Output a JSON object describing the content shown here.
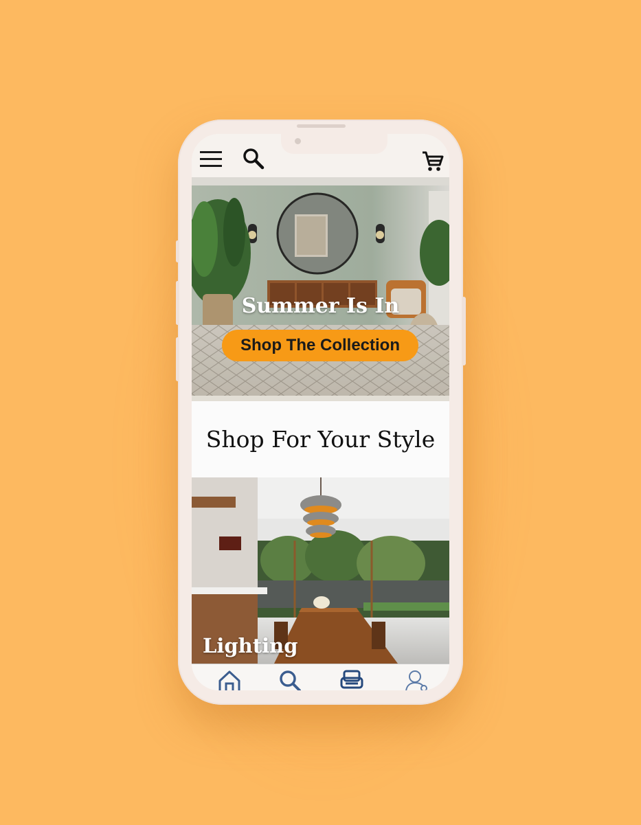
{
  "header": {
    "menu_icon": "hamburger-menu-icon",
    "search_icon": "search-icon",
    "cart_icon": "shopping-cart-icon"
  },
  "hero": {
    "title": "Summer Is In",
    "cta_label": "Shop The Collection"
  },
  "section": {
    "title": "Shop For Your Style"
  },
  "categories": [
    {
      "label": "Lighting"
    }
  ],
  "tabbar": {
    "items": [
      {
        "icon": "home-icon",
        "active": false
      },
      {
        "icon": "search-icon",
        "active": false
      },
      {
        "icon": "sofa-icon",
        "active": true
      },
      {
        "icon": "account-icon",
        "active": false
      }
    ]
  },
  "colors": {
    "background": "#fdb960",
    "accent": "#f79a16",
    "tab_icon": "#3b5d8f"
  }
}
